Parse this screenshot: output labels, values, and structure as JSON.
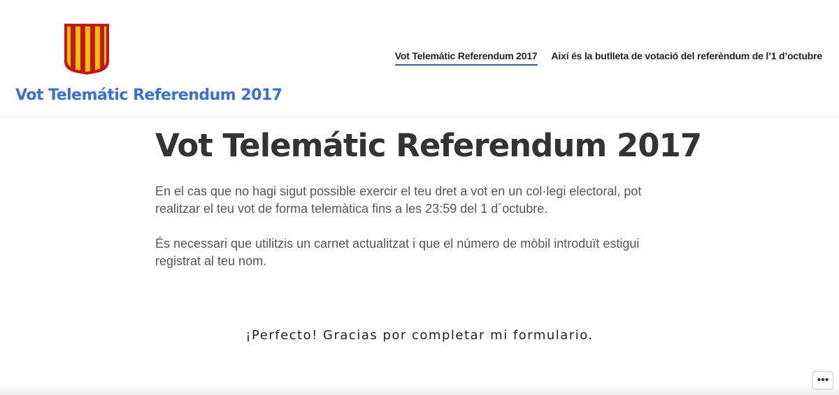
{
  "header": {
    "site_title": "Vot Telemátic Referendum 2017",
    "logo_icon": "senyera-shield-icon",
    "logo_colors": {
      "red": "#c4161c",
      "gold": "#f2c200"
    },
    "nav": [
      {
        "label": "Vot Telemátic Referendum 2017",
        "active": true
      },
      {
        "label": "Així és la butlleta de votació del referèndum de l’1 d’octubre",
        "active": false
      }
    ]
  },
  "main": {
    "title": "Vot Telemátic Referendum 2017",
    "paragraphs": [
      "En el cas que no hagi sigut possible exercir el teu dret a vot en un col·legi electoral, pot realitzar el teu vot de forma telemàtica fins a les 23:59 del 1 d´octubre.",
      "És necessari que utilitzis un carnet actualitzat i que el número de mòbil introduït estigui registrat al teu nom."
    ],
    "thanks": "¡Perfecto! Gracias por completar mi formulario."
  },
  "footer": {
    "more_icon": "ellipsis-icon",
    "more_label": "•••"
  },
  "colors": {
    "accent": "#3c6fd2",
    "title_text": "#333333",
    "body_text": "#555555"
  }
}
